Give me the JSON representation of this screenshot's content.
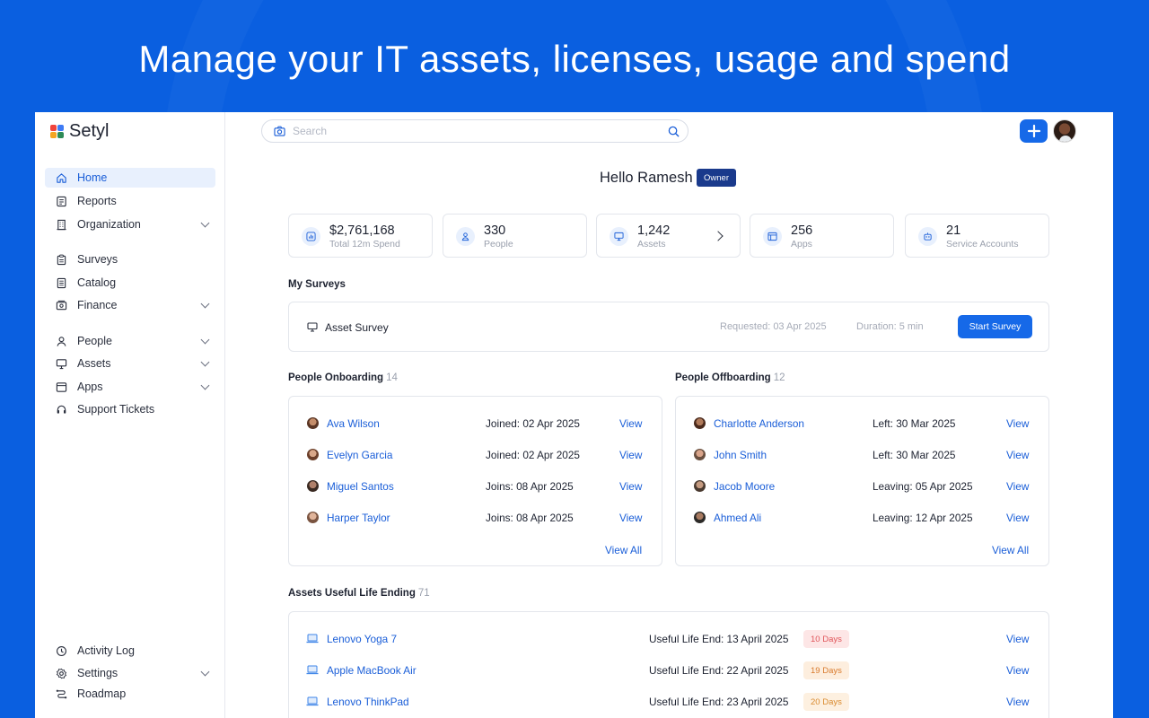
{
  "headline": "Manage your IT assets, licenses, usage and spend",
  "brand": {
    "name": "Setyl",
    "colors": [
      "#f0443c",
      "#2e8b57",
      "#f5a623",
      "#3e7bf5"
    ]
  },
  "sidebar": {
    "items": [
      {
        "label": "Home",
        "icon": "home-icon",
        "active": true
      },
      {
        "label": "Reports",
        "icon": "reports-icon"
      },
      {
        "label": "Organization",
        "icon": "building-icon",
        "expandable": true
      },
      {
        "label": "Surveys",
        "icon": "clipboard-icon"
      },
      {
        "label": "Catalog",
        "icon": "catalog-icon"
      },
      {
        "label": "Finance",
        "icon": "finance-icon",
        "expandable": true
      },
      {
        "label": "People",
        "icon": "person-icon",
        "expandable": true
      },
      {
        "label": "Assets",
        "icon": "monitor-icon",
        "expandable": true
      },
      {
        "label": "Apps",
        "icon": "apps-icon",
        "expandable": true
      },
      {
        "label": "Support Tickets",
        "icon": "headset-icon"
      }
    ],
    "bottom_items": [
      {
        "label": "Activity Log",
        "icon": "history-icon"
      },
      {
        "label": "Settings",
        "icon": "gear-icon",
        "expandable": true
      },
      {
        "label": "Roadmap",
        "icon": "roadmap-icon"
      }
    ]
  },
  "search": {
    "placeholder": "Search"
  },
  "greeting": {
    "text": "Hello Ramesh",
    "role": "Owner"
  },
  "stats": [
    {
      "value": "$2,761,168",
      "label": "Total 12m Spend",
      "icon": "chart-icon"
    },
    {
      "value": "330",
      "label": "People",
      "icon": "person-icon"
    },
    {
      "value": "1,242",
      "label": "Assets",
      "icon": "monitor-icon",
      "has_arrow": true
    },
    {
      "value": "256",
      "label": "Apps",
      "icon": "apps-icon"
    },
    {
      "value": "21",
      "label": "Service Accounts",
      "icon": "robot-icon"
    }
  ],
  "surveys": {
    "title": "My Surveys",
    "item": {
      "name": "Asset Survey",
      "requested": "Requested: 03 Apr 2025",
      "duration": "Duration: 5 min",
      "button": "Start Survey"
    }
  },
  "onboarding": {
    "title": "People Onboarding",
    "count": "14",
    "rows": [
      {
        "name": "Ava Wilson",
        "date": "Joined: 02 Apr 2025",
        "action": "View"
      },
      {
        "name": "Evelyn Garcia",
        "date": "Joined: 02 Apr 2025",
        "action": "View"
      },
      {
        "name": "Miguel Santos",
        "date": "Joins: 08 Apr 2025",
        "action": "View"
      },
      {
        "name": "Harper Taylor",
        "date": "Joins: 08 Apr 2025",
        "action": "View"
      }
    ],
    "view_all": "View All"
  },
  "offboarding": {
    "title": "People Offboarding",
    "count": "12",
    "rows": [
      {
        "name": "Charlotte Anderson",
        "date": "Left: 30 Mar 2025",
        "action": "View"
      },
      {
        "name": "John Smith",
        "date": "Left: 30 Mar 2025",
        "action": "View"
      },
      {
        "name": "Jacob Moore",
        "date": "Leaving: 05 Apr 2025",
        "action": "View"
      },
      {
        "name": "Ahmed Ali",
        "date": "Leaving: 12 Apr 2025",
        "action": "View"
      }
    ],
    "view_all": "View All"
  },
  "assets_life": {
    "title": "Assets Useful Life Ending",
    "count": "71",
    "rows": [
      {
        "name": "Lenovo Yoga 7",
        "date": "Useful Life End: 13 April 2025",
        "badge": "10 Days",
        "badge_color": "#fde6e6",
        "badge_text": "#e0555a",
        "action": "View"
      },
      {
        "name": "Apple MacBook Air",
        "date": "Useful Life End: 22 April 2025",
        "badge": "19 Days",
        "badge_color": "#fdeede",
        "badge_text": "#d97b2e",
        "action": "View"
      },
      {
        "name": "Lenovo ThinkPad",
        "date": "Useful Life End: 23 April 2025",
        "badge": "20 Days",
        "badge_color": "#fdf0e0",
        "badge_text": "#d98a2e",
        "action": "View"
      }
    ]
  }
}
